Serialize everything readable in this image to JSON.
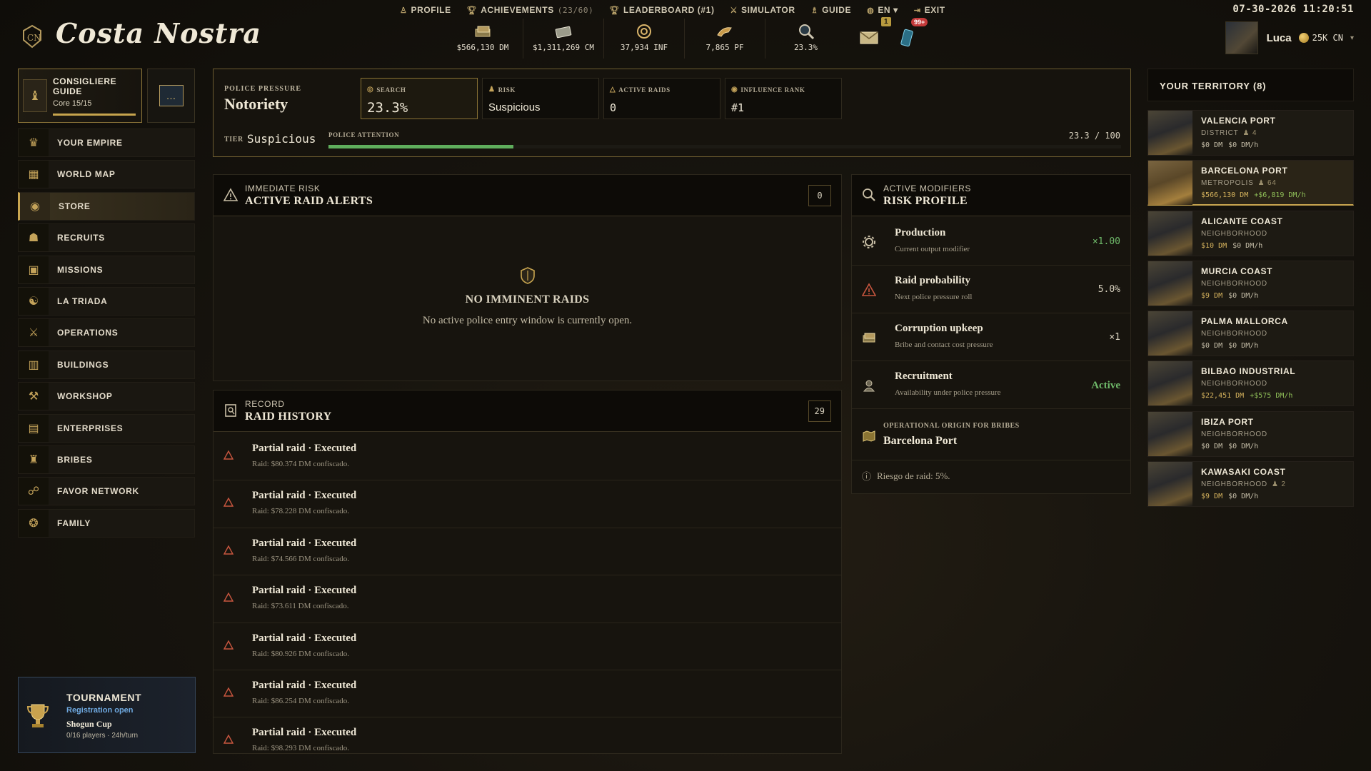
{
  "app": {
    "title": "Costa Nostra"
  },
  "nav": [
    {
      "icon": "person-icon",
      "label": "PROFILE",
      "count": ""
    },
    {
      "icon": "trophy-icon",
      "label": "ACHIEVEMENTS",
      "count": "(23/60)"
    },
    {
      "icon": "trophy-icon",
      "label": "LEADERBOARD (#1)",
      "count": ""
    },
    {
      "icon": "swords-icon",
      "label": "SIMULATOR",
      "count": ""
    },
    {
      "icon": "guide-icon",
      "label": "GUIDE",
      "count": ""
    },
    {
      "icon": "globe-icon",
      "label": "EN ▾",
      "count": ""
    },
    {
      "icon": "exit-icon",
      "label": "EXIT",
      "count": ""
    }
  ],
  "clock": "07-30-2026 11:20:51",
  "stats": [
    {
      "icon": "cash-stack-icon",
      "value": "$566,130 DM"
    },
    {
      "icon": "banknotes-icon",
      "value": "$1,311,269 CM"
    },
    {
      "icon": "influence-icon",
      "value": "37,934 INF"
    },
    {
      "icon": "favor-icon",
      "value": "7,865 PF"
    },
    {
      "icon": "magnifier-icon",
      "value": "23.3%"
    }
  ],
  "notifications": {
    "mail_badge": "1",
    "phone_badge": "99+"
  },
  "user": {
    "name": "Luca",
    "currency": "25K CN"
  },
  "guide": {
    "title": "CONSIGLIERE GUIDE",
    "progress_text": "Core 15/15",
    "progress": 1.0
  },
  "menu": [
    {
      "icon": "crown-icon",
      "label": "YOUR EMPIRE",
      "active": false
    },
    {
      "icon": "map-icon",
      "label": "WORLD MAP",
      "active": false
    },
    {
      "icon": "coin-icon",
      "label": "STORE",
      "active": true
    },
    {
      "icon": "recruits-icon",
      "label": "RECRUITS",
      "active": false
    },
    {
      "icon": "missions-icon",
      "label": "MISSIONS",
      "active": false
    },
    {
      "icon": "triad-icon",
      "label": "LA TRIADA",
      "active": false
    },
    {
      "icon": "crossed-swords-icon",
      "label": "OPERATIONS",
      "active": false
    },
    {
      "icon": "building-icon",
      "label": "BUILDINGS",
      "active": false
    },
    {
      "icon": "workshop-icon",
      "label": "WORKSHOP",
      "active": false
    },
    {
      "icon": "enterprise-icon",
      "label": "ENTERPRISES",
      "active": false
    },
    {
      "icon": "bribe-icon",
      "label": "BRIBES",
      "active": false
    },
    {
      "icon": "handshake-icon",
      "label": "FAVOR NETWORK",
      "active": false
    },
    {
      "icon": "family-icon",
      "label": "FAMILY",
      "active": false
    }
  ],
  "tournament": {
    "title": "TOURNAMENT",
    "status": "Registration open",
    "name": "Shogun Cup",
    "players": "0/16 players · 24h/turn"
  },
  "pressure": {
    "label": "POLICE PRESSURE",
    "title": "Notoriety",
    "cards": [
      {
        "label": "SEARCH",
        "value": "23.3%"
      },
      {
        "label": "RISK",
        "value": "Suspicious"
      },
      {
        "label": "ACTIVE RAIDS",
        "value": "0"
      },
      {
        "label": "INFLUENCE RANK",
        "value": "#1"
      }
    ],
    "tier_label": "TIER",
    "tier": "Suspicious",
    "attention_label": "POLICE ATTENTION",
    "attention_value": 23.3,
    "attention_max": 100,
    "attention_text": "23.3 / 100"
  },
  "alerts": {
    "subtitle": "IMMEDIATE RISK",
    "title": "ACTIVE RAID ALERTS",
    "count": "0",
    "empty_title": "NO IMMINENT RAIDS",
    "empty_text": "No active police entry window is currently open."
  },
  "history": {
    "subtitle": "RECORD",
    "title": "RAID HISTORY",
    "count": "29",
    "rows": [
      {
        "title": "Partial raid · Executed",
        "detail": "Raid: $80.374 DM confiscado."
      },
      {
        "title": "Partial raid · Executed",
        "detail": "Raid: $78.228 DM confiscado."
      },
      {
        "title": "Partial raid · Executed",
        "detail": "Raid: $74.566 DM confiscado."
      },
      {
        "title": "Partial raid · Executed",
        "detail": "Raid: $73.611 DM confiscado."
      },
      {
        "title": "Partial raid · Executed",
        "detail": "Raid: $80.926 DM confiscado."
      },
      {
        "title": "Partial raid · Executed",
        "detail": "Raid: $86.254 DM confiscado."
      },
      {
        "title": "Partial raid · Executed",
        "detail": "Raid: $98.293 DM confiscado."
      }
    ]
  },
  "risk": {
    "subtitle": "ACTIVE MODIFIERS",
    "title": "RISK PROFILE",
    "rows": [
      {
        "icon": "gear-icon",
        "title": "Production",
        "sub": "Current output modifier",
        "value": "×1.00",
        "style": "green"
      },
      {
        "icon": "warning-icon",
        "title": "Raid probability",
        "sub": "Next police pressure roll",
        "value": "5.0%",
        "style": ""
      },
      {
        "icon": "money-icon",
        "title": "Corruption upkeep",
        "sub": "Bribe and contact cost pressure",
        "value": "×1",
        "style": ""
      },
      {
        "icon": "recruits-icon",
        "title": "Recruitment",
        "sub": "Availability under police pressure",
        "value": "Active",
        "style": "green active"
      }
    ],
    "origin_label": "OPERATIONAL ORIGIN FOR BRIBES",
    "origin": "Barcelona Port",
    "note": "Riesgo de raid: 5%."
  },
  "territory": {
    "title": "YOUR TERRITORY (8)",
    "items": [
      {
        "name": "VALENCIA PORT",
        "type": "DISTRICT",
        "bonus": "4",
        "money": "$0 DM",
        "rate": "$0 DM/h",
        "money_style": "",
        "rate_style": "",
        "selected": false
      },
      {
        "name": "BARCELONA PORT",
        "type": "METROPOLIS",
        "bonus": "64",
        "money": "$566,130 DM",
        "rate": "+$6,819 DM/h",
        "money_style": "gold",
        "rate_style": "green",
        "selected": true
      },
      {
        "name": "ALICANTE COAST",
        "type": "NEIGHBORHOOD",
        "bonus": "",
        "money": "$10 DM",
        "rate": "$0 DM/h",
        "money_style": "gold",
        "rate_style": "",
        "selected": false
      },
      {
        "name": "MURCIA COAST",
        "type": "NEIGHBORHOOD",
        "bonus": "",
        "money": "$9 DM",
        "rate": "$0 DM/h",
        "money_style": "gold",
        "rate_style": "",
        "selected": false
      },
      {
        "name": "PALMA MALLORCA",
        "type": "NEIGHBORHOOD",
        "bonus": "",
        "money": "$0 DM",
        "rate": "$0 DM/h",
        "money_style": "",
        "rate_style": "",
        "selected": false
      },
      {
        "name": "BILBAO INDUSTRIAL",
        "type": "NEIGHBORHOOD",
        "bonus": "",
        "money": "$22,451 DM",
        "rate": "+$575 DM/h",
        "money_style": "gold",
        "rate_style": "green",
        "selected": false
      },
      {
        "name": "IBIZA PORT",
        "type": "NEIGHBORHOOD",
        "bonus": "",
        "money": "$0 DM",
        "rate": "$0 DM/h",
        "money_style": "",
        "rate_style": "",
        "selected": false
      },
      {
        "name": "KAWASAKI COAST",
        "type": "NEIGHBORHOOD",
        "bonus": "2",
        "money": "$9 DM",
        "rate": "$0 DM/h",
        "money_style": "gold",
        "rate_style": "",
        "selected": false
      }
    ]
  }
}
